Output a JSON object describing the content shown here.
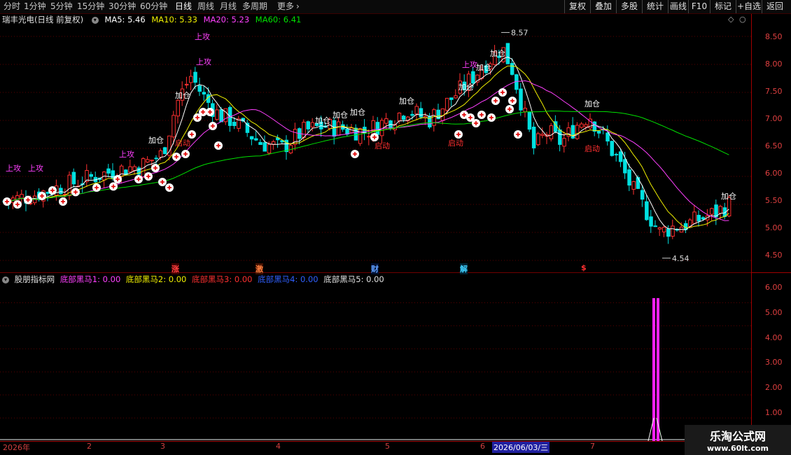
{
  "toolbar": {
    "period_tabs": [
      "分时",
      "1分钟",
      "5分钟",
      "15分钟",
      "30分钟",
      "60分钟",
      "日线",
      "周线",
      "月线",
      "多周期",
      "更多"
    ],
    "right_buttons": [
      "复权",
      "叠加",
      "多股",
      "统计",
      "画线",
      "F10",
      "标记",
      "+自选",
      "返回"
    ]
  },
  "stock": {
    "title": "瑞丰光电(日线 前复权)",
    "ma5": "MA5: 5.46",
    "ma10": "MA10: 5.33",
    "ma20": "MA20: 5.23",
    "ma60": "MA60: 6.41"
  },
  "colors": {
    "ma5": "#ffffff",
    "ma10": "#f0f000",
    "ma20": "#ff40ff",
    "ma60": "#00e000",
    "up": "#ff3030",
    "down": "#00e0e0"
  },
  "price_axis": [
    "8.50",
    "8.00",
    "7.50",
    "7.00",
    "6.50",
    "6.00",
    "5.50",
    "5.00",
    "4.50"
  ],
  "annotations": {
    "high": "8.57",
    "low": "4.54"
  },
  "signals": {
    "attack": "上攻",
    "add": "加仓",
    "start": "启动"
  },
  "events": [
    "涨",
    "激",
    "财",
    "解",
    "$"
  ],
  "indicator": {
    "name": "股朋指标网",
    "lines": [
      "底部黑马1: 0.00",
      "底部黑马2: 0.00",
      "底部黑马3: 0.00",
      "底部黑马4: 0.00",
      "底部黑马5: 0.00"
    ],
    "axis": [
      "6.00",
      "5.00",
      "4.00",
      "3.00",
      "2.00",
      "1.00"
    ]
  },
  "dates": [
    "2026年",
    "2",
    "3",
    "4",
    "5",
    "6",
    "2026/06/03/三",
    "7"
  ],
  "watermark": {
    "line1": "乐淘公式网",
    "line2": "www.60lt.com"
  },
  "chart_data": {
    "type": "candlestick",
    "symbol": "瑞丰光电",
    "period": "日线 前复权",
    "ylim": [
      4.3,
      8.7
    ],
    "moving_averages": {
      "MA5": 5.46,
      "MA10": 5.33,
      "MA20": 5.23,
      "MA60": 6.41
    },
    "high": 8.57,
    "low": 4.54,
    "indicator_ylim": [
      0,
      6.5
    ]
  }
}
